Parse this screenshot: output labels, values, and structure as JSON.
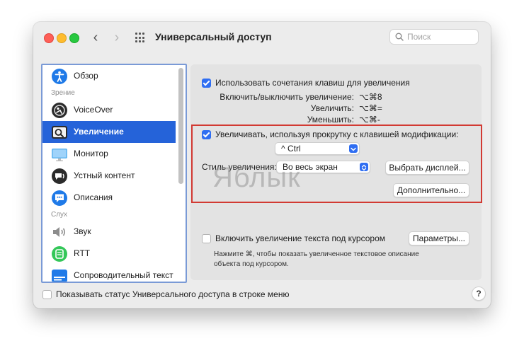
{
  "window": {
    "title": "Универсальный доступ"
  },
  "search": {
    "placeholder": "Поиск"
  },
  "sidebar": {
    "items": [
      {
        "label": "Обзор",
        "icon": "accessibility-icon"
      },
      {
        "section": "Зрение"
      },
      {
        "label": "VoiceOver",
        "icon": "voiceover-icon"
      },
      {
        "label": "Увеличение",
        "icon": "zoom-icon",
        "selected": true
      },
      {
        "label": "Монитор",
        "icon": "display-icon"
      },
      {
        "label": "Устный контент",
        "icon": "speech-icon"
      },
      {
        "label": "Описания",
        "icon": "descriptions-icon"
      },
      {
        "section": "Слух"
      },
      {
        "label": "Звук",
        "icon": "speaker-icon"
      },
      {
        "label": "RTT",
        "icon": "rtt-icon"
      },
      {
        "label": "Сопроводительный текст",
        "icon": "captions-icon"
      }
    ]
  },
  "pane": {
    "keyboard_zoom": {
      "label": "Использовать сочетания клавиш для увеличения",
      "checked": true,
      "shortcuts": [
        {
          "label": "Включить/выключить увеличение:",
          "keys": "⌥⌘8"
        },
        {
          "label": "Увеличить:",
          "keys": "⌥⌘="
        },
        {
          "label": "Уменьшить:",
          "keys": "⌥⌘-"
        }
      ]
    },
    "scroll_zoom": {
      "label": "Увеличивать, используя прокрутку с клавишей модификации:",
      "checked": true,
      "modifier": "^ Ctrl"
    },
    "zoom_style": {
      "label": "Стиль увеличения:",
      "value": "Во весь экран",
      "choose_display_button": "Выбрать дисплей...",
      "advanced_button": "Дополнительно..."
    },
    "hover_text": {
      "label": "Включить увеличение текста под курсором",
      "checked": false,
      "params_button": "Параметры...",
      "description": "Нажмите ⌘, чтобы показать увеличенное текстовое описание объекта под курсором."
    }
  },
  "footer": {
    "menu_status_label": "Показывать статус Универсального доступа в строке меню",
    "menu_status_checked": false,
    "help_label": "?"
  },
  "watermark": "Яблык",
  "colors": {
    "accent": "#2f6ef2",
    "selection": "#2563d9",
    "highlight_box": "#d23a33"
  }
}
